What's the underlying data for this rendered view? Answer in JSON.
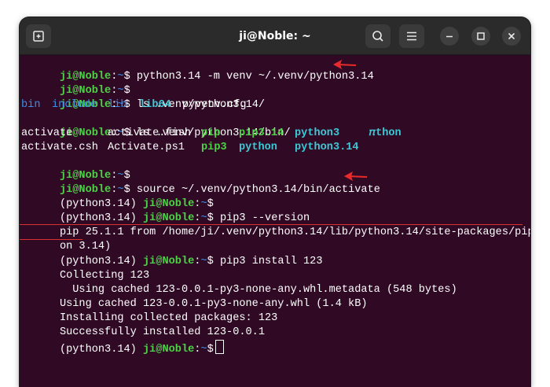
{
  "window": {
    "title": "ji@Noble: ~"
  },
  "titlebar": {
    "new_tab_icon": "new-tab-icon",
    "search_icon": "search-icon",
    "menu_icon": "hamburger-menu-icon",
    "minimize_icon": "minimize-icon",
    "maximize_icon": "maximize-icon",
    "close_icon": "close-icon"
  },
  "colors": {
    "terminal_bg": "#300a24",
    "prompt_green": "#4dd247",
    "dir_blue": "#3b8ee8",
    "link_cyan": "#3ec8d6",
    "annotation_red": "#d93030"
  },
  "prompt": {
    "user_host": "ji@Noble",
    "colon": ":",
    "dir": "~",
    "symbol": "$",
    "venv": "(python3.14) "
  },
  "terminal": {
    "cmd1": " python3.14 -m venv ~/.venv/python3.14",
    "cmd3": " ls .venv/python3.14/",
    "ls1": {
      "bin": "bin",
      "include": "include",
      "lib": "lib",
      "lib64": "lib64",
      "cfg": "pyvenv.cfg"
    },
    "cmd5": " ls .venv/python3.14/bin/",
    "ls2": {
      "r1c1": "activate",
      "r1c2": "activate.fish",
      "r1c3": "pip",
      "r1c4": "pip3.14",
      "r1c5": "python3",
      "r1c6": "𝜋thon",
      "r2c1": "activate.csh",
      "r2c2": "Activate.ps1",
      "r2c3": "pip3",
      "r2c4": "python",
      "r2c5": "python3.14"
    },
    "cmd9": " source ~/.venv/python3.14/bin/activate",
    "cmd12": " pip3 --version",
    "out13": "pip 25.1.1 from /home/ji/.venv/python3.14/lib/python3.14/site-packages/pip (pyth",
    "out14": "on 3.14)",
    "cmd15": " pip3 install 123",
    "out16": "Collecting 123",
    "out17": "  Using cached 123-0.0.1-py3-none-any.whl.metadata (548 bytes)",
    "out18": "Using cached 123-0.0.1-py3-none-any.whl (1.4 kB)",
    "out19": "Installing collected packages: 123",
    "out20": "Successfully installed 123-0.0.1"
  }
}
